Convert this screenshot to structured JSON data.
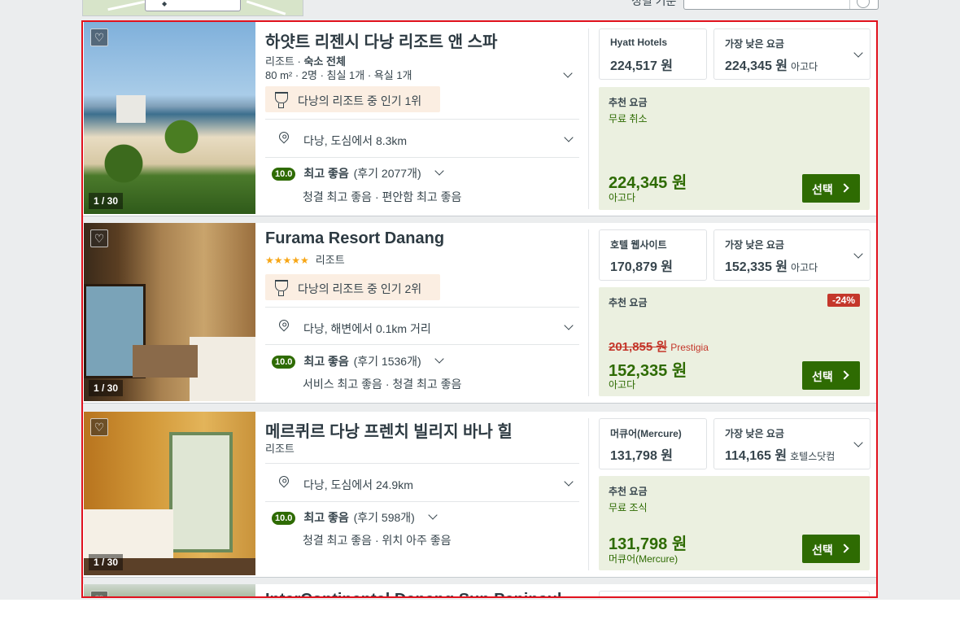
{
  "sort": {
    "label": "정렬 기준"
  },
  "hotels": [
    {
      "name": "하얏트 리젠시 다낭 리조트 앤 스파",
      "type": "리조트",
      "subtype": "숙소 전체",
      "details": "80 m² · 2명 · 침실 1개 · 욕실 1개",
      "popularity": "다낭의 리조트 중 인기 1위",
      "location": "다낭, 도심에서 8.3km",
      "score": "10.0",
      "rating_label": "최고 좋음",
      "reviews": "(후기 2077개)",
      "rating_detail": "청결 최고 좋음 · 편안함 최고 좋음",
      "photo_counter": "1 / 30",
      "deal1": {
        "title": "Hyatt Hotels",
        "price": "224,517 원"
      },
      "deal2": {
        "title": "가장 낮은 요금",
        "price": "224,345 원",
        "provider": "아고다"
      },
      "rec": {
        "title": "추천 요금",
        "note": "무료 취소",
        "price": "224,345 원",
        "provider": "아고다"
      },
      "select": "선택"
    },
    {
      "name": "Furama Resort Danang",
      "stars": "★★★★★",
      "type": "리조트",
      "popularity": "다낭의 리조트 중 인기 2위",
      "location": "다낭, 해변에서 0.1km 거리",
      "score": "10.0",
      "rating_label": "최고 좋음",
      "reviews": "(후기 1536개)",
      "rating_detail": "서비스 최고 좋음 · 청결 최고 좋음",
      "photo_counter": "1 / 30",
      "deal1": {
        "title": "호텔 웹사이트",
        "price": "170,879 원"
      },
      "deal2": {
        "title": "가장 낮은 요금",
        "price": "152,335 원",
        "provider": "아고다"
      },
      "rec": {
        "title": "추천 요금",
        "discount": "-24%",
        "old_price": "201,855 원",
        "old_provider": "Prestigia",
        "price": "152,335 원",
        "provider": "아고다"
      },
      "select": "선택"
    },
    {
      "name": "메르퀴르 다낭 프렌치 빌리지 바나 힐",
      "type": "리조트",
      "location": "다낭, 도심에서 24.9km",
      "score": "10.0",
      "rating_label": "최고 좋음",
      "reviews": "(후기 598개)",
      "rating_detail": "청결 최고 좋음 · 위치 아주 좋음",
      "photo_counter": "1 / 30",
      "deal1": {
        "title": "머큐어(Mercure)",
        "price": "131,798 원"
      },
      "deal2": {
        "title": "가장 낮은 요금",
        "price": "114,165 원",
        "provider": "호텔스닷컴"
      },
      "rec": {
        "title": "추천 요금",
        "note": "무료 조식",
        "price": "131,798 원",
        "provider": "머큐어(Mercure)"
      },
      "select": "선택"
    },
    {
      "name": "InterContinental Danang Sun Peninsul"
    }
  ]
}
